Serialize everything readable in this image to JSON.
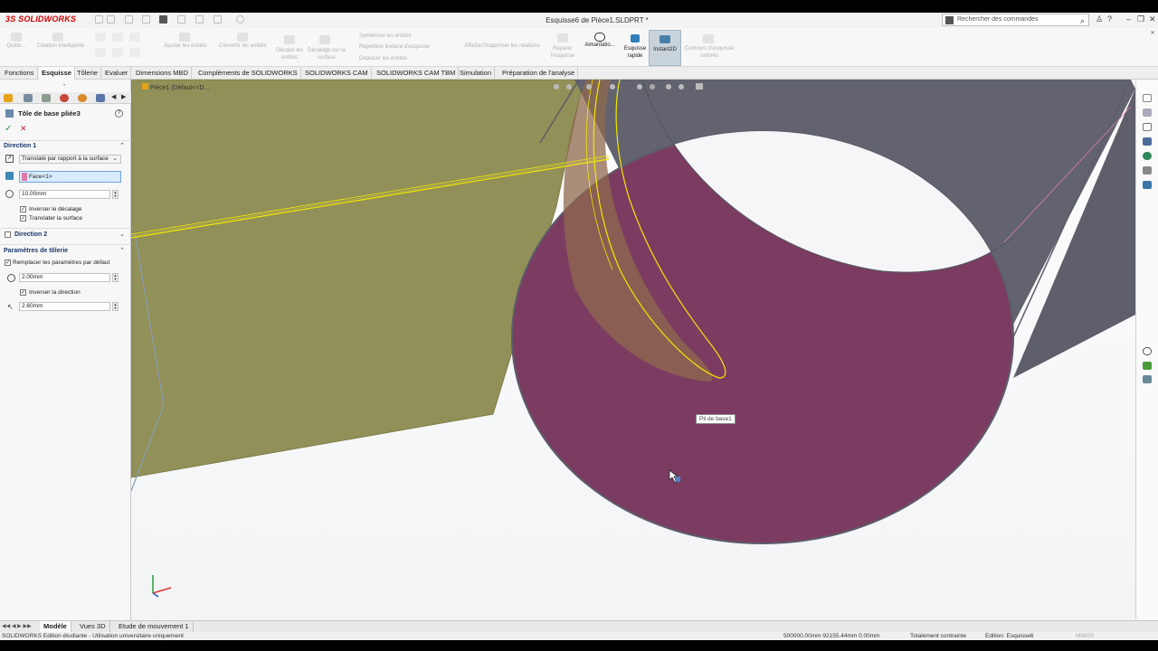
{
  "window": {
    "title": "Esquisse6 de Pièce1.SLDPRT *",
    "logo": "SOLIDWORKS",
    "search_placeholder": "Rechercher des commandes"
  },
  "ribbon": {
    "quitter": "Quitte...",
    "cotation": "Cotation intelligente",
    "ajuster": "Ajuster les entités",
    "convertir": "Convertir les entités",
    "decaler": "Décaler les entités",
    "decalage_surface": "Décalage sur la surface",
    "symetriser": "Symétriser les entités",
    "repetition": "Répétition linéaire d'esquisse",
    "deplacer": "Déplacer les entités",
    "afficher_relations": "Afficher/Supprimer les relations",
    "reparer": "Réparer l'esquisse",
    "aimantation": "Aimantatio...",
    "esquisse_rapide": "Esquisse rapide",
    "instant2d": "Instant2D",
    "contours": "Contours d'esquisse ombrés"
  },
  "tabs": [
    {
      "label": "Fonctions"
    },
    {
      "label": "Esquisse"
    },
    {
      "label": "Tôlerie"
    },
    {
      "label": "Evaluer"
    },
    {
      "label": "Dimensions MBD"
    },
    {
      "label": "Compléments de SOLIDWORKS"
    },
    {
      "label": "SOLIDWORKS CAM"
    },
    {
      "label": "SOLIDWORKS CAM TBM"
    },
    {
      "label": "Simulation"
    },
    {
      "label": "Préparation de l'analyse"
    }
  ],
  "panel": {
    "title": "Tôle de base pliée3",
    "direction1": {
      "header": "Direction 1",
      "type": "Translaté par rapport à la surface",
      "face": "Face<1>",
      "distance": "10.00mm",
      "inverser_decalage": "Inverser le décalage",
      "translater_surface": "Translater la surface"
    },
    "direction2": {
      "header": "Direction 2"
    },
    "parametres": {
      "header": "Paramètres de tôlerie",
      "remplacer": "Remplacer les paramètres par défaut",
      "epaisseur": "2.00mm",
      "inverser_direction": "Inverser la direction",
      "rayon": "2.60mm"
    }
  },
  "viewport": {
    "breadcrumb": "Pièce1  (Défaut<<D...",
    "tooltip": "Pli de base1"
  },
  "bottom_tabs": [
    {
      "label": "Modèle"
    },
    {
      "label": "Vues 3D"
    },
    {
      "label": "Etude de mouvement 1"
    }
  ],
  "status": {
    "left": "SOLIDWORKS Edition étudiante - Utilisation universitaire uniquement",
    "coords": "500000.00mm    92155.44mm   0.00mm",
    "constraint": "Totalement contrainte",
    "editing": "Edition: Esquisse6",
    "units": "MMGS"
  },
  "colors": {
    "face_magenta": "#7c3c62",
    "plane_olive": "#8d8c53",
    "sketch_yellow": "#f5e800",
    "ribbon_bg": "#f7f7f7"
  }
}
